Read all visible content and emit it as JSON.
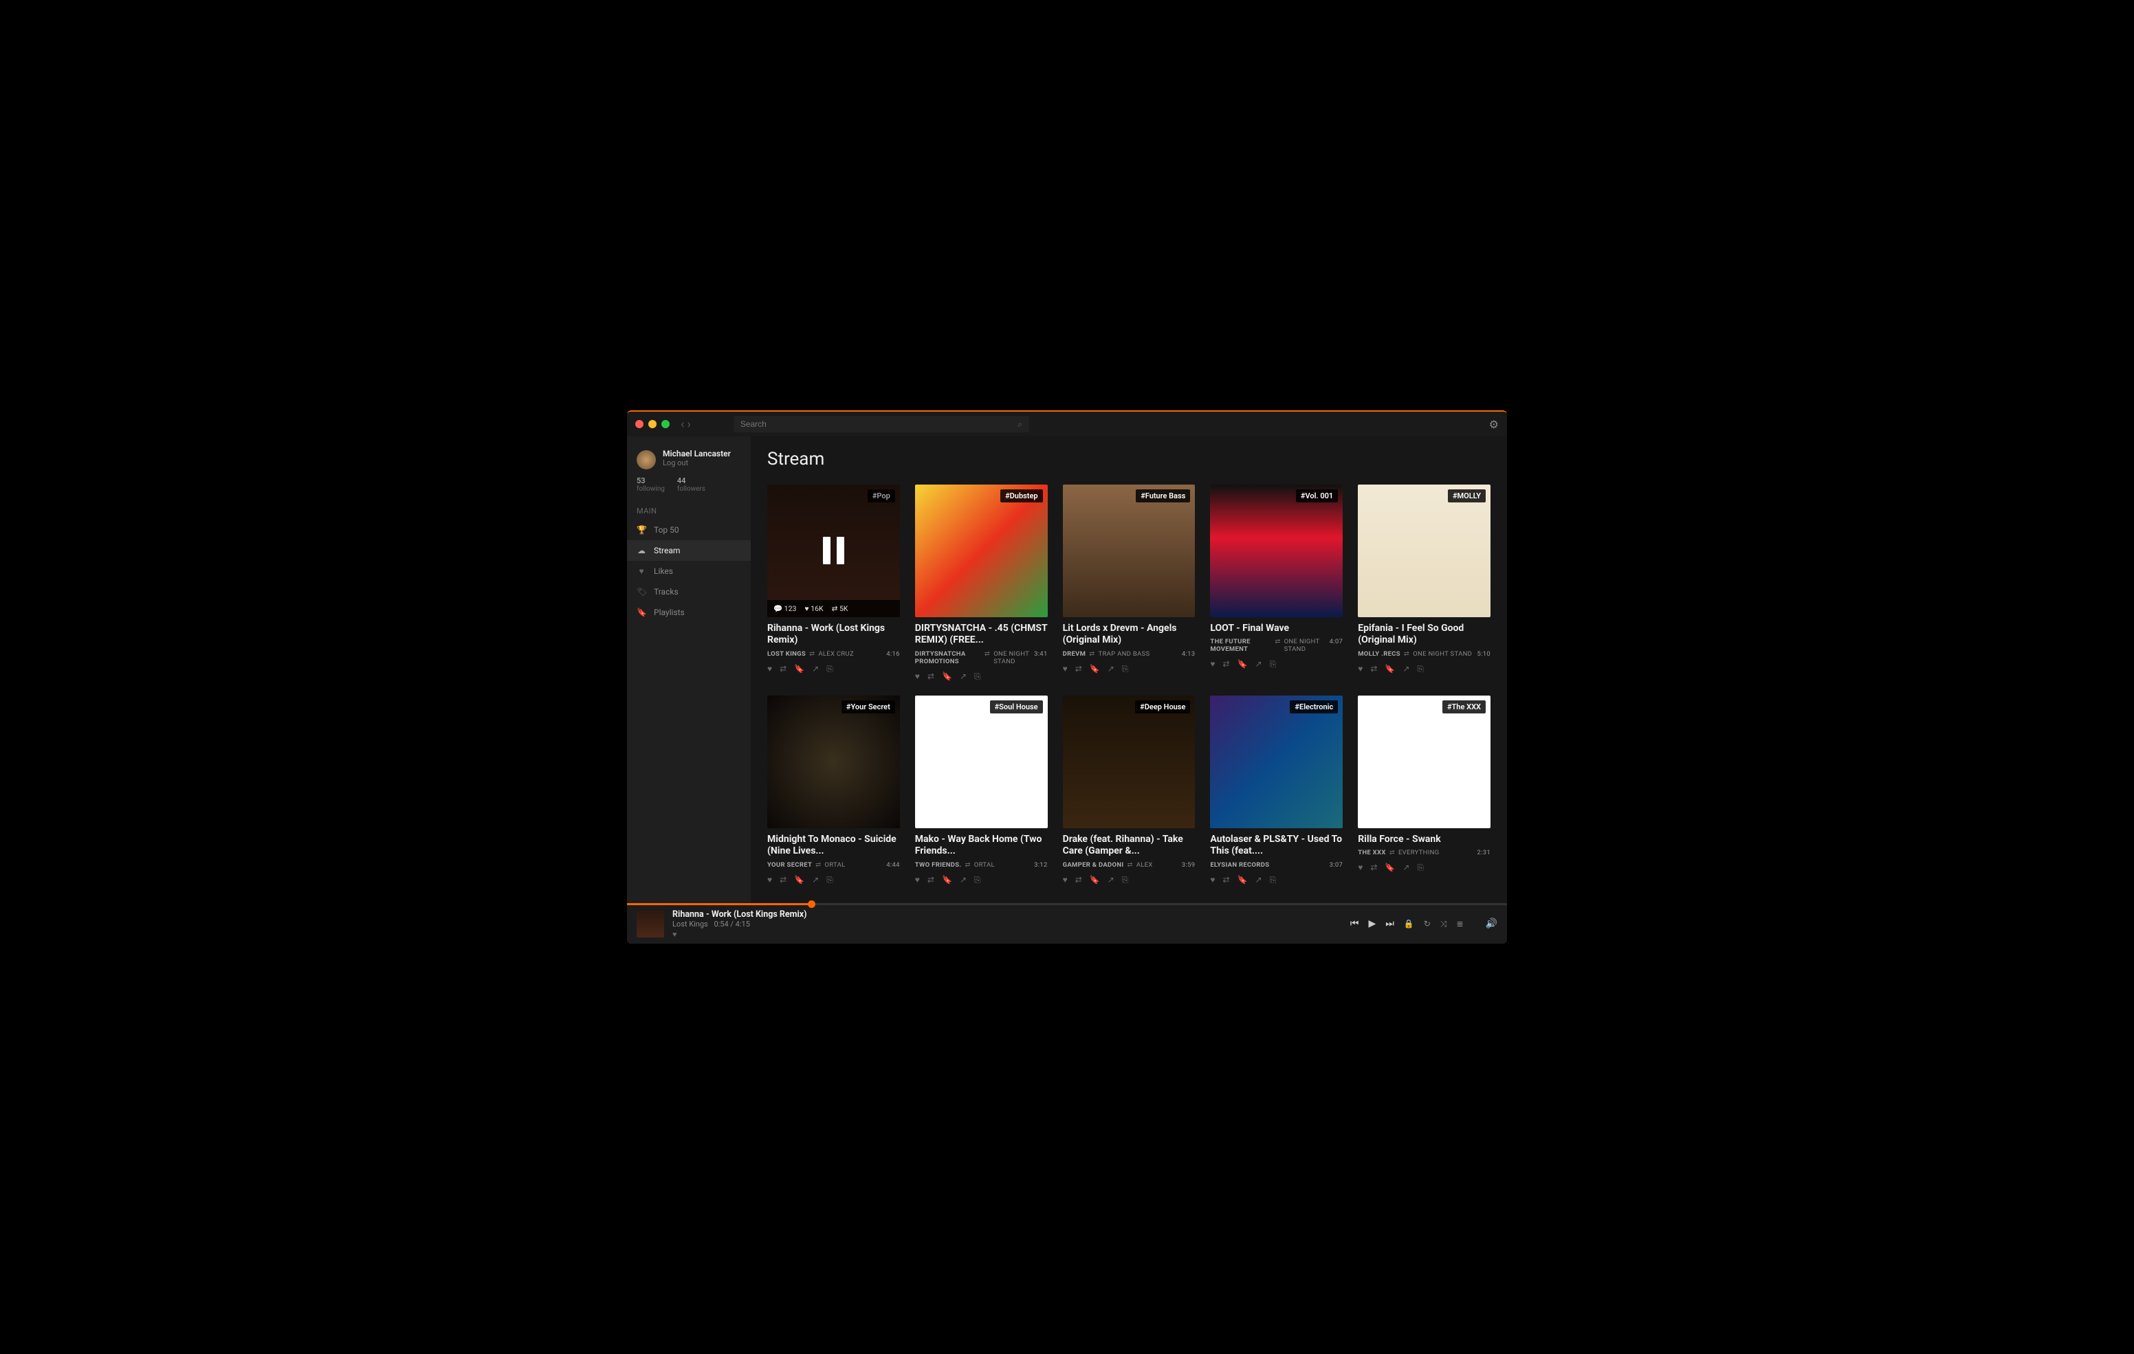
{
  "search": {
    "placeholder": "Search"
  },
  "user": {
    "name": "Michael Lancaster",
    "logout": "Log out",
    "following_count": "53",
    "following_label": "following",
    "followers_count": "44",
    "followers_label": "followers"
  },
  "sidebar": {
    "main_header": "MAIN",
    "items": [
      {
        "icon": "trophy",
        "label": "Top 50"
      },
      {
        "icon": "cloud",
        "label": "Stream",
        "active": true
      },
      {
        "icon": "heart",
        "label": "Likes"
      },
      {
        "icon": "tag",
        "label": "Tracks"
      },
      {
        "icon": "bookmark",
        "label": "Playlists"
      }
    ]
  },
  "page_title": "Stream",
  "tracks": [
    {
      "tag": "#Pop",
      "title": "Rihanna - Work (Lost Kings Remix)",
      "artist": "LOST KINGS",
      "reposter": "ALEX CRUZ",
      "duration": "4:16",
      "playing": true,
      "stats": {
        "comments": "123",
        "likes": "16K",
        "reposts": "5K"
      }
    },
    {
      "tag": "#Dubstep",
      "title": "DIRTYSNATCHA - .45 (CHMST REMIX) (FREE...",
      "artist": "DIRTYSNATCHA PROMOTIONS",
      "reposter": "ONE NIGHT STAND",
      "duration": "3:41"
    },
    {
      "tag": "#Future Bass",
      "title": "Lit Lords x Drevm - Angels (Original Mix)",
      "artist": "DREVM",
      "reposter": "TRAP AND BASS",
      "duration": "4:13"
    },
    {
      "tag": "#Vol. 001",
      "title": "LOOT - Final Wave",
      "artist": "THE FUTURE MOVEMENT",
      "reposter": "ONE NIGHT STAND",
      "duration": "4:07"
    },
    {
      "tag": "#MOLLY",
      "title": "Epifania - I Feel So Good (Original Mix)",
      "artist": "MOLLY .RECS",
      "reposter": "ONE NIGHT STAND",
      "duration": "5:10"
    },
    {
      "tag": "#Your Secret",
      "title": "Midnight To Monaco - Suicide (Nine Lives...",
      "artist": "YOUR SECRET",
      "reposter": "ORTAL",
      "duration": "4:44"
    },
    {
      "tag": "#Soul House",
      "title": "Mako - Way Back Home (Two Friends...",
      "artist": "TWO FRIENDS.",
      "reposter": "ORTAL",
      "duration": "3:12"
    },
    {
      "tag": "#Deep House",
      "title": "Drake (feat. Rihanna) - Take Care (Gamper &...",
      "artist": "GAMPER & DADONI",
      "reposter": "ALEX",
      "duration": "3:59"
    },
    {
      "tag": "#Electronic",
      "title": "Autolaser & PLS&TY - Used To This (feat....",
      "artist": "ELYSIAN RECORDS",
      "reposter": "",
      "duration": "3:07"
    },
    {
      "tag": "#The XXX",
      "title": "Rilla Force - Swank",
      "artist": "THE XXX",
      "reposter": "EVERYTHING",
      "duration": "2:31"
    }
  ],
  "player": {
    "title": "Rihanna - Work (Lost Kings Remix)",
    "artist": "Lost Kings",
    "elapsed": "0:54",
    "total": "4:15"
  }
}
